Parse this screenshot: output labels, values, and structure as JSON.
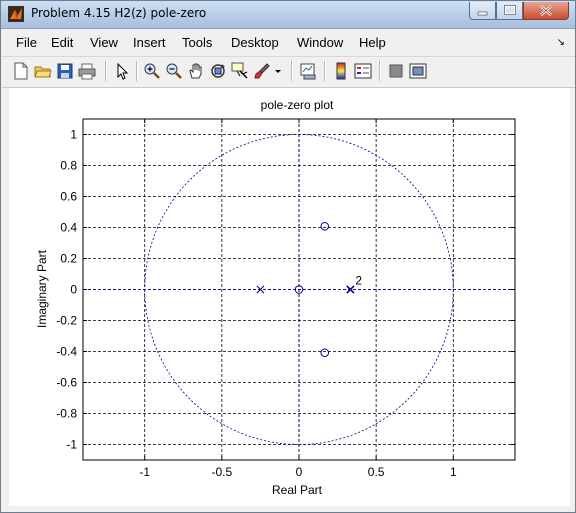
{
  "window": {
    "title": "Problem 4.15 H2(z) pole-zero"
  },
  "menubar": {
    "items": [
      "File",
      "Edit",
      "View",
      "Insert",
      "Tools",
      "Desktop",
      "Window",
      "Help"
    ]
  },
  "toolbar": {
    "icons": [
      "new-figure-icon",
      "open-file-icon",
      "save-icon",
      "print-icon",
      "pointer-icon",
      "zoom-in-icon",
      "zoom-out-icon",
      "pan-icon",
      "rotate-icon",
      "data-cursor-icon",
      "brush-icon",
      "dropdown-arrow-icon",
      "link-plot-icon",
      "colorbar-icon",
      "legend-icon",
      "hide-plot-tools-icon",
      "show-plot-tools-icon"
    ]
  },
  "colors": {
    "plot": "#00008b",
    "titlebar": "#b6cce6"
  },
  "chart_data": {
    "type": "scatter",
    "title": "pole-zero plot",
    "xlabel": "Real Part",
    "ylabel": "Imaginary Part",
    "xlim": [
      -1.4,
      1.4
    ],
    "ylim": [
      -1.1,
      1.1
    ],
    "xticks": [
      -1,
      -0.5,
      0,
      0.5,
      1
    ],
    "xtick_labels": [
      "-1",
      "-0.5",
      "0",
      "0.5",
      "1"
    ],
    "yticks": [
      1,
      0.8,
      0.6,
      0.4,
      0.2,
      0,
      -0.2,
      -0.4,
      -0.6,
      -0.8,
      -1
    ],
    "ytick_labels": [
      "1",
      "0.8",
      "0.6",
      "0.4",
      "0.2",
      "0",
      "-0.2",
      "-0.4",
      "-0.6",
      "-0.8",
      "-1"
    ],
    "grid": true,
    "unit_circle": true,
    "zeros": [
      {
        "x": 0,
        "y": 0
      },
      {
        "x": 0.167,
        "y": 0.408
      },
      {
        "x": 0.167,
        "y": -0.408
      }
    ],
    "poles": [
      {
        "x": -0.25,
        "y": 0,
        "label": ""
      },
      {
        "x": 0.333,
        "y": 0,
        "label": "2"
      }
    ]
  }
}
